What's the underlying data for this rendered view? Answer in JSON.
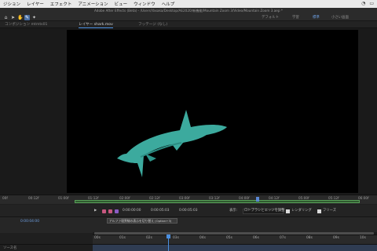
{
  "menubar": {
    "items": [
      "ジション",
      "レイヤー",
      "エフェクト",
      "アニメーション",
      "ビュー",
      "ウィンドウ",
      "ヘルプ"
    ]
  },
  "titlebar": {
    "text": "Adobe After Effects (Beta) - /Users/Yasaka/Desktop/AE2020/新機能/Mountain Zoom 3/Video/Mountain Zoom 3.aep *"
  },
  "toolbar": {
    "workspaces": [
      "デフォルト",
      "学習",
      "標準",
      "小さい画面"
    ]
  },
  "tabs": [
    {
      "label": "コンポジション mtmts01"
    },
    {
      "label": "レイヤー  shark.mov"
    },
    {
      "label": "フッテージ (なし)"
    }
  ],
  "layer_ruler": {
    "ticks": [
      "00f",
      "00:12f",
      "01:00f",
      "01:12f",
      "02:00f",
      "02:12f",
      "03:00f",
      "03:12f",
      "04:00f",
      "04:12f",
      "05:00f",
      "05:12f",
      "06:00f"
    ]
  },
  "layer_controls": {
    "in_time": "0:00:00:00",
    "out_time": "0:00:05:03",
    "duration": "0:00:05:03",
    "view_label": "表示:",
    "view_value": "ロトブラシとエッジを調整",
    "render_label": "レンダリング",
    "freeze_label": "フリーズ"
  },
  "timeline": {
    "timecode": "0:00:04:00",
    "tooltip": "アルファ境界線の表示を切り替え (Option+3)",
    "ticks": [
      "00s",
      "01s",
      "02s",
      "03s",
      "04s",
      "05s",
      "06s",
      "07s",
      "08s",
      "09s",
      "10s"
    ],
    "source_name": "ソース名"
  },
  "colors": {
    "accent": "#4a8fe0",
    "shark": "#3fb3a6",
    "viewer_bg": "#000000"
  },
  "icons": [
    "wifi-icon",
    "battery-icon",
    "clock-icon",
    "home-icon",
    "selection-icon",
    "hand-icon",
    "brush-icon",
    "pin-icon",
    "refine-edge-icon",
    "play-icon"
  ]
}
